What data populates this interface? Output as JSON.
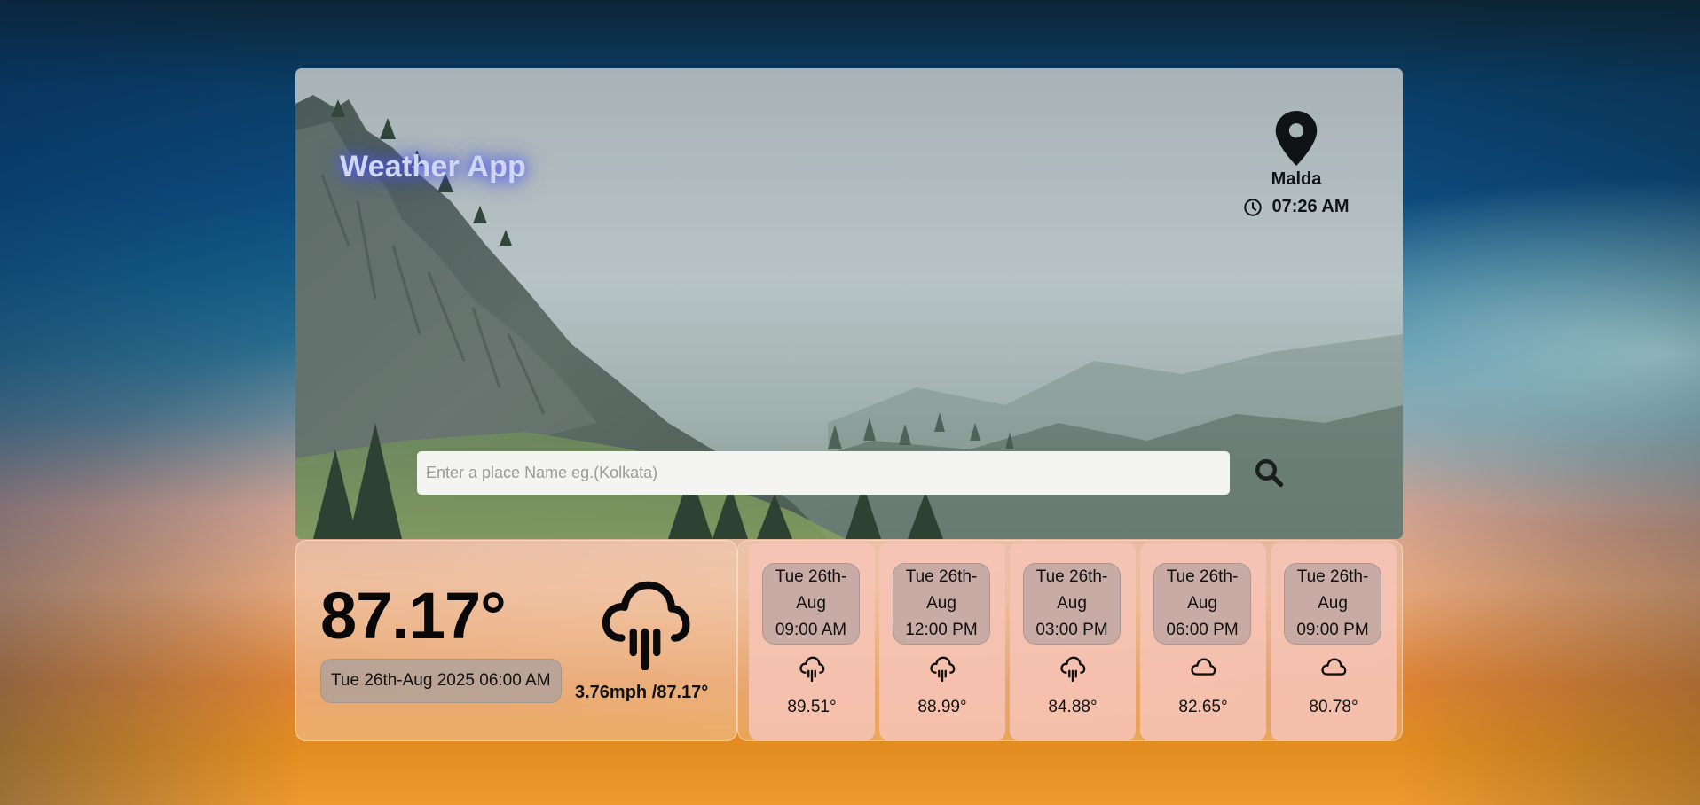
{
  "app": {
    "title": "Weather App"
  },
  "location": {
    "city": "Malda",
    "time": "07:26 AM",
    "icon": "map-pin-icon"
  },
  "search": {
    "placeholder": "Enter a place Name eg.(Kolkata)",
    "value": "",
    "icon": "search-icon"
  },
  "current": {
    "temperature": "87.17°",
    "date": "Tue 26th-Aug 2025 06:00 AM",
    "wind_feels": "3.76mph /87.17°",
    "icon": "cloud-rain-icon"
  },
  "forecast": [
    {
      "day": "Tue 26th-",
      "month": "Aug",
      "time": "09:00 AM",
      "icon": "cloud-rain-icon",
      "temp": "89.51°"
    },
    {
      "day": "Tue 26th-",
      "month": "Aug",
      "time": "12:00 PM",
      "icon": "cloud-rain-icon",
      "temp": "88.99°"
    },
    {
      "day": "Tue 26th-",
      "month": "Aug",
      "time": "03:00 PM",
      "icon": "cloud-rain-icon",
      "temp": "84.88°"
    },
    {
      "day": "Tue 26th-",
      "month": "Aug",
      "time": "06:00 PM",
      "icon": "cloud-icon",
      "temp": "82.65°"
    },
    {
      "day": "Tue 26th-",
      "month": "Aug",
      "time": "09:00 PM",
      "icon": "cloud-icon",
      "temp": "80.78°"
    }
  ],
  "colors": {
    "title_glow": "#4b50ff",
    "title_text": "#cfd7f2",
    "search_bg": "#f4f4f2",
    "card_tint": "#f6c4b6"
  }
}
